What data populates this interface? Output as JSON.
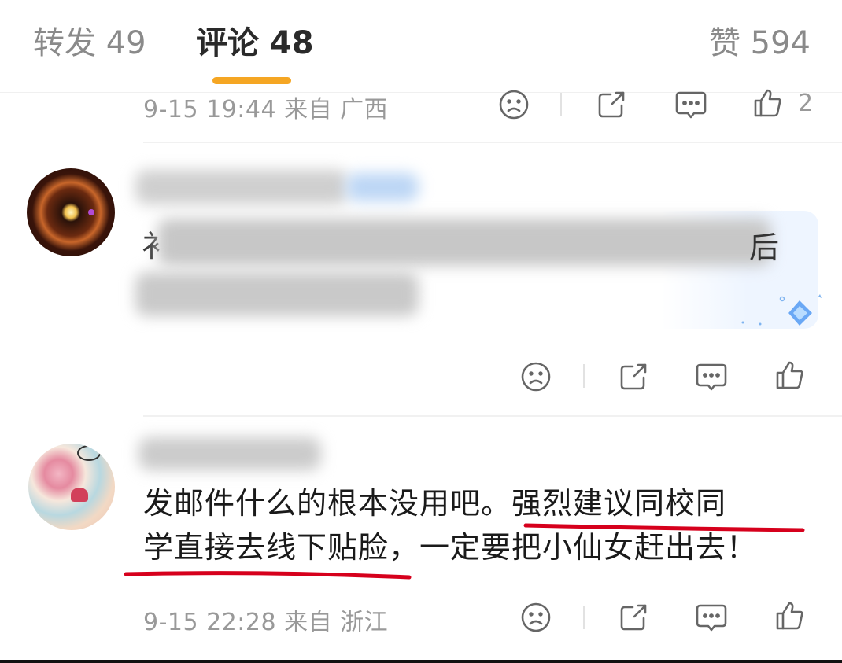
{
  "tabs": {
    "repost": "转发 49",
    "comment": "评论 48",
    "like": "赞 594"
  },
  "comments": [
    {
      "meta": "9-15 19:44 来自 广西",
      "like_count": "2"
    },
    {
      "name": "",
      "text_visible_tail": "后",
      "leading_char_1": "衤",
      "leading_char_2": "",
      "like_count": ""
    },
    {
      "name": "",
      "text_line1": "发邮件什么的根本没用吧。强烈建议同校同",
      "text_line2": "学直接去线下贴脸，一定要把小仙女赶出去！",
      "meta": "9-15 22:28 来自 浙江",
      "like_count": ""
    }
  ],
  "icons": {
    "dislike": "frown-face-icon",
    "share": "share-icon",
    "reply": "comment-bubble-icon",
    "like": "thumbs-up-icon",
    "badge": "diamond-badge-icon"
  },
  "colors": {
    "tab_underline": "#f5a623",
    "annotation_red": "#d6001c",
    "accent": "#ff7a1a"
  }
}
